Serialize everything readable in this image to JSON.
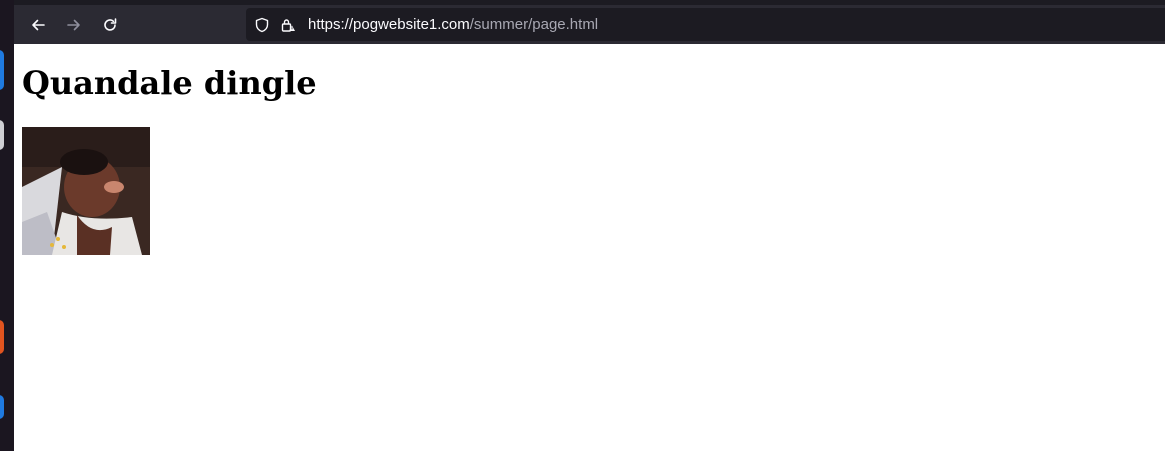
{
  "browser": {
    "url_host": "https://pogwebsite1.com",
    "url_path": "/summer/page.html",
    "back_icon": "arrow-left-icon",
    "forward_icon": "arrow-right-icon",
    "reload_icon": "reload-icon",
    "tracking_icon": "shield-icon",
    "security_icon": "lock-warning-icon"
  },
  "page": {
    "heading": "Quandale dingle",
    "image_icon": "photo-image"
  },
  "colors": {
    "toolbar_bg": "#2b2a33",
    "urlbar_bg": "#1c1b22",
    "dock_bg": "#1b1620",
    "page_bg": "#ffffff"
  }
}
